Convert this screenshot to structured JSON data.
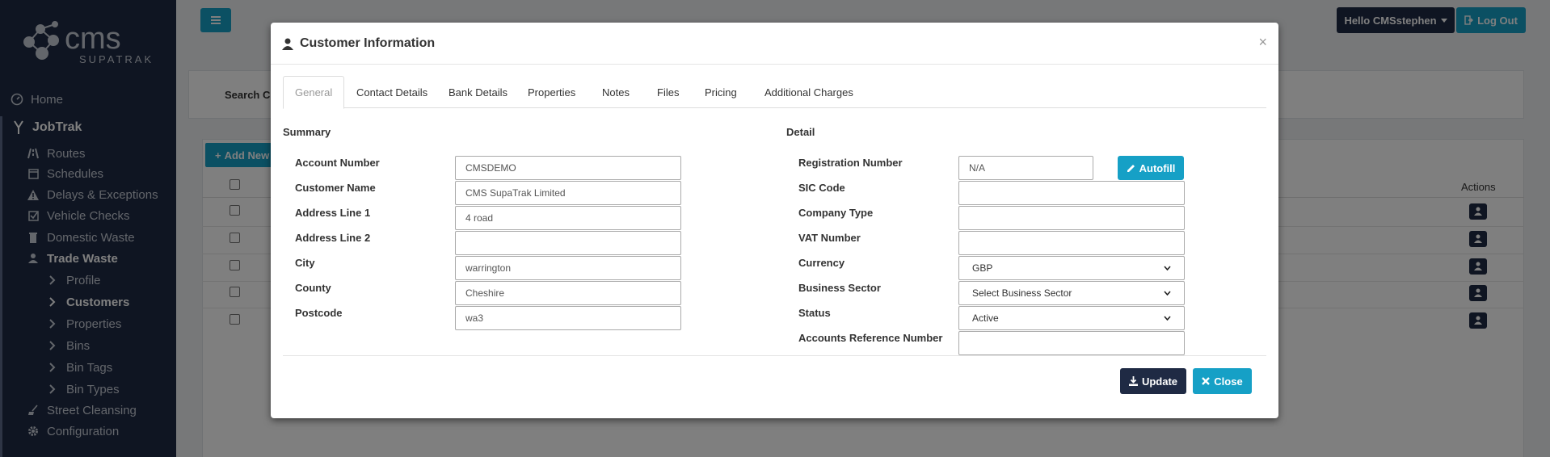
{
  "brand": {
    "logo_text": "cms",
    "logo_subtext": "SUPATRAK"
  },
  "sidebar": {
    "items": [
      {
        "label": "Home",
        "icon": "dashboard-icon"
      },
      {
        "label": "JobTrak",
        "icon": "fork-icon"
      },
      {
        "label": "Routes",
        "icon": "road-icon"
      },
      {
        "label": "Schedules",
        "icon": "calendar-icon"
      },
      {
        "label": "Delays & Exceptions",
        "icon": "warning-icon"
      },
      {
        "label": "Vehicle Checks",
        "icon": "checkbox-icon"
      },
      {
        "label": "Domestic Waste",
        "icon": "bin-icon"
      },
      {
        "label": "Trade Waste",
        "icon": "users-icon"
      },
      {
        "label": "Profile",
        "icon": "chevron-right-icon"
      },
      {
        "label": "Customers",
        "icon": "chevron-right-icon"
      },
      {
        "label": "Properties",
        "icon": "chevron-right-icon"
      },
      {
        "label": "Bins",
        "icon": "chevron-right-icon"
      },
      {
        "label": "Bin Tags",
        "icon": "chevron-right-icon"
      },
      {
        "label": "Bin Types",
        "icon": "chevron-right-icon"
      },
      {
        "label": "Street Cleansing",
        "icon": "broom-icon"
      },
      {
        "label": "Configuration",
        "icon": "gear-icon"
      }
    ]
  },
  "topbar": {
    "hello_label": "Hello CMSstephen",
    "logout_label": "Log Out"
  },
  "background": {
    "search_label": "Search Cu",
    "add_new_label": "Add New",
    "actions_header": "Actions"
  },
  "modal": {
    "title": "Customer Information",
    "close_x": "×",
    "tabs": [
      {
        "label": "General"
      },
      {
        "label": "Contact Details"
      },
      {
        "label": "Bank Details"
      },
      {
        "label": "Properties"
      },
      {
        "label": "Notes"
      },
      {
        "label": "Files"
      },
      {
        "label": "Pricing"
      },
      {
        "label": "Additional Charges"
      }
    ],
    "summary": {
      "title": "Summary",
      "fields": [
        {
          "label": "Account Number",
          "value": "CMSDEMO"
        },
        {
          "label": "Customer Name",
          "value": "CMS SupaTrak Limited"
        },
        {
          "label": "Address Line 1",
          "value": "4 road"
        },
        {
          "label": "Address Line 2",
          "value": ""
        },
        {
          "label": "City",
          "value": "warrington"
        },
        {
          "label": "County",
          "value": "Cheshire"
        },
        {
          "label": "Postcode",
          "value": "wa3"
        }
      ]
    },
    "detail": {
      "title": "Detail",
      "registration_label": "Registration Number",
      "registration_value": "N/A",
      "autofill_label": "Autofill",
      "sic_label": "SIC Code",
      "sic_value": "",
      "company_type_label": "Company Type",
      "company_type_value": "",
      "vat_label": "VAT Number",
      "vat_value": "",
      "currency_label": "Currency",
      "currency_value": "GBP",
      "sector_label": "Business Sector",
      "sector_value": "Select Business Sector",
      "status_label": "Status",
      "status_value": "Active",
      "accounts_ref_label": "Accounts Reference Number",
      "accounts_ref_value": ""
    },
    "update_label": "Update",
    "close_label": "Close"
  },
  "colors": {
    "navy": "#1f2a44",
    "accent": "#16a0c6"
  }
}
